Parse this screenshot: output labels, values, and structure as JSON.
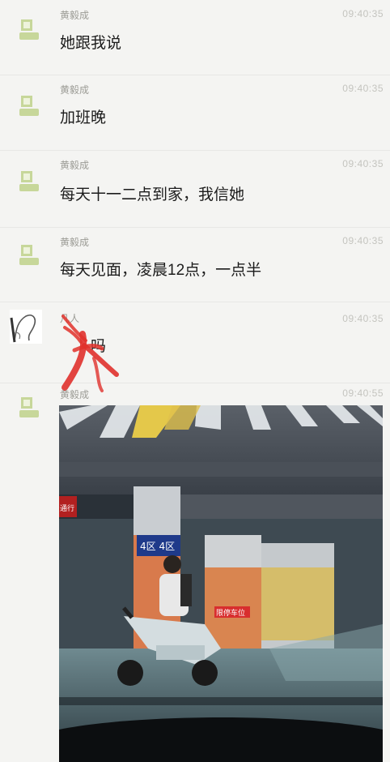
{
  "messages": [
    {
      "sender": "黄毅成",
      "time": "09:40:35",
      "text": "她跟我说"
    },
    {
      "sender": "黄毅成",
      "time": "09:40:35",
      "text": "加班晚"
    },
    {
      "sender": "黄毅成",
      "time": "09:40:35",
      "text": "每天十一二点到家，我信她"
    },
    {
      "sender": "黄毅成",
      "time": "09:40:35",
      "text": "每天见面，凌晨12点，一点半"
    },
    {
      "sender": "凡人",
      "time": "09:40:35",
      "text": "吗"
    },
    {
      "sender": "黄毅成",
      "time": "09:40:55"
    }
  ],
  "photo": {
    "pillar_sign": "4区 4区",
    "red_sign": "限停车位",
    "left_sign": "通行"
  },
  "colors": {
    "background": "#f4f4f2",
    "avatar": "#c7d79a",
    "redaction": "#e0312c"
  }
}
